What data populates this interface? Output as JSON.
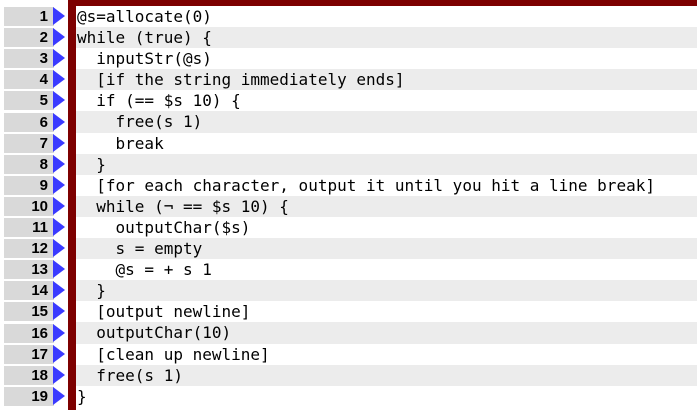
{
  "editor": {
    "lines": [
      {
        "num": "1",
        "text": "@s=allocate(0)"
      },
      {
        "num": "2",
        "text": "while (true) {"
      },
      {
        "num": "3",
        "text": "  inputStr(@s)"
      },
      {
        "num": "4",
        "text": "  [if the string immediately ends]"
      },
      {
        "num": "5",
        "text": "  if (== $s 10) {"
      },
      {
        "num": "6",
        "text": "    free(s 1)"
      },
      {
        "num": "7",
        "text": "    break"
      },
      {
        "num": "8",
        "text": "  }"
      },
      {
        "num": "9",
        "text": "  [for each character, output it until you hit a line break]"
      },
      {
        "num": "10",
        "text": "  while (¬ == $s 10) {"
      },
      {
        "num": "11",
        "text": "    outputChar($s)"
      },
      {
        "num": "12",
        "text": "    s = empty"
      },
      {
        "num": "13",
        "text": "    @s = + s 1"
      },
      {
        "num": "14",
        "text": "  }"
      },
      {
        "num": "15",
        "text": "  [output newline]"
      },
      {
        "num": "16",
        "text": "  outputChar(10)"
      },
      {
        "num": "17",
        "text": "  [clean up newline]"
      },
      {
        "num": "18",
        "text": "  free(s 1)"
      },
      {
        "num": "19",
        "text": "}"
      }
    ],
    "colors": {
      "border": "#7d0000",
      "gutter_bg": "#d9d9d9",
      "arrow": "#3a3aff",
      "alt_row": "#ececec"
    },
    "icons": {
      "line_marker": "triangle-right-icon"
    }
  }
}
